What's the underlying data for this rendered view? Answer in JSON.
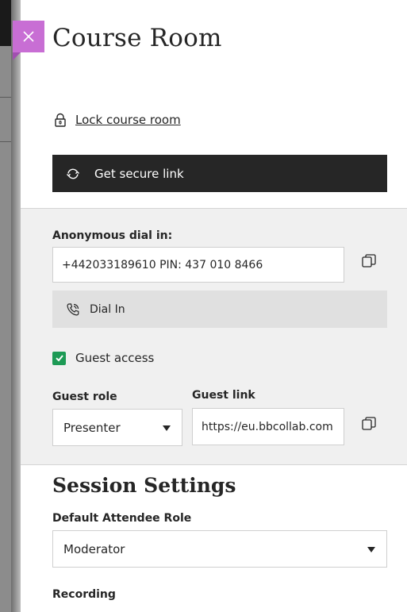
{
  "header": {
    "title": "Course Room",
    "close_icon": "close-icon"
  },
  "lock": {
    "label": "Lock course room",
    "icon": "lock-icon"
  },
  "secure_link": {
    "label": "Get secure link",
    "icon": "refresh-icon"
  },
  "dial_in": {
    "label": "Anonymous dial in:",
    "value": "+442033189610 PIN: 437 010 8466",
    "button_label": "Dial In",
    "button_icon": "phone-icon",
    "copy_icon": "copy-icon"
  },
  "guest": {
    "checkbox_label": "Guest access",
    "checked": true,
    "role_label": "Guest role",
    "role_value": "Presenter",
    "link_label": "Guest link",
    "link_value": "https://eu.bbcollab.com",
    "copy_icon": "copy-icon"
  },
  "session": {
    "title": "Session Settings",
    "default_role_label": "Default Attendee Role",
    "default_role_value": "Moderator",
    "recording_label": "Recording"
  },
  "colors": {
    "close_accent": "#c86ed4",
    "checkbox_green": "#1d9a55",
    "dark_button": "#262626"
  }
}
